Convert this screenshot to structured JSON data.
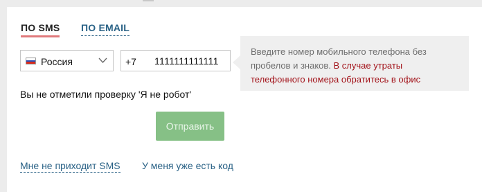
{
  "tabs": [
    {
      "label": "ПО SMS",
      "active": true
    },
    {
      "label": "ПО EMAIL",
      "active": false
    }
  ],
  "country": {
    "selected": "Россия",
    "flag_icon": "russia-flag-icon"
  },
  "phone": {
    "code": "+7",
    "value": "1111111111111"
  },
  "hint": {
    "text_gray": "Введите номер мобильного телефона без пробелов и знаков. ",
    "text_red": "В случае утраты телефонного номера обратитесь в офис"
  },
  "captcha_error": "Вы не отметили проверку 'Я не робот'",
  "submit_label": "Отправить",
  "links": {
    "no_sms": "Мне не приходит SMS",
    "have_code": "У меня уже есть код"
  },
  "colors": {
    "active_tab_underline": "#e0797b",
    "link": "#2a6286",
    "button": "#86c086",
    "hint_warning": "#a3141b"
  }
}
